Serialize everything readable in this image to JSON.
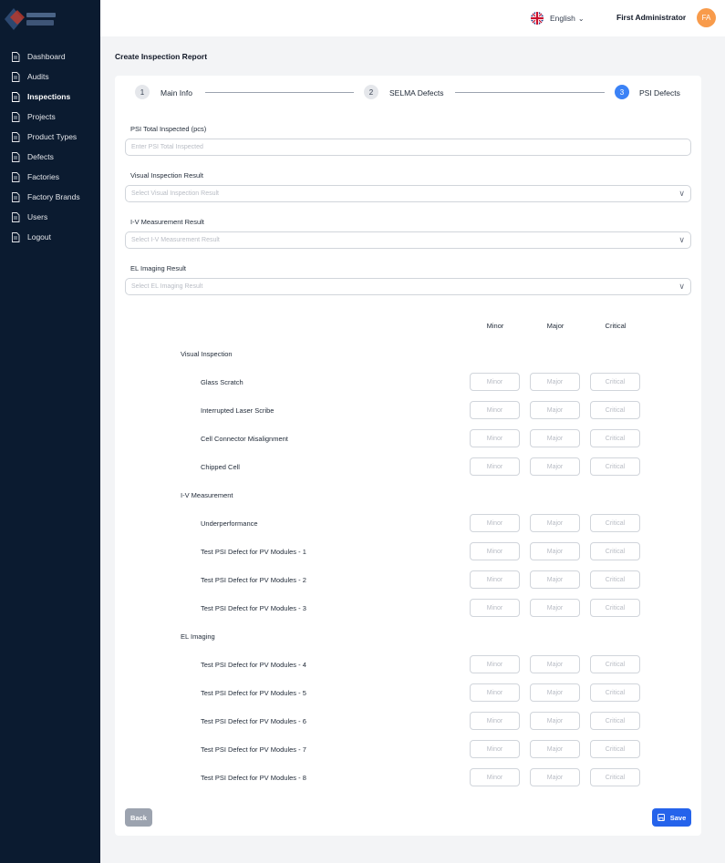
{
  "sidebar": {
    "items": [
      {
        "label": "Dashboard",
        "icon": "document-icon",
        "active": false
      },
      {
        "label": "Audits",
        "icon": "document-icon",
        "active": false
      },
      {
        "label": "Inspections",
        "icon": "document-icon",
        "active": true
      },
      {
        "label": "Projects",
        "icon": "document-icon",
        "active": false
      },
      {
        "label": "Product Types",
        "icon": "document-icon",
        "active": false
      },
      {
        "label": "Defects",
        "icon": "document-icon",
        "active": false
      },
      {
        "label": "Factories",
        "icon": "document-icon",
        "active": false
      },
      {
        "label": "Factory Brands",
        "icon": "document-icon",
        "active": false
      },
      {
        "label": "Users",
        "icon": "document-icon",
        "active": false
      },
      {
        "label": "Logout",
        "icon": "document-icon",
        "active": false
      }
    ]
  },
  "header": {
    "language": "English",
    "flag_icon": "uk-flag-icon",
    "user_name": "First Administrator",
    "avatar_initials": "FA",
    "avatar_color": "#f89b4b"
  },
  "page": {
    "title": "Create Inspection Report"
  },
  "stepper": {
    "steps": [
      {
        "number": "1",
        "label": "Main Info",
        "active": false
      },
      {
        "number": "2",
        "label": "SELMA Defects",
        "active": false
      },
      {
        "number": "3",
        "label": "PSI Defects",
        "active": true
      }
    ],
    "accent": "#3b82f6"
  },
  "form": {
    "total_inspected": {
      "label": "PSI Total Inspected (pcs)",
      "placeholder": "Enter PSI Total Inspected"
    },
    "visual_result": {
      "label": "Visual Inspection Result",
      "placeholder": "Select Visual Inspection Result"
    },
    "iv_result": {
      "label": "I-V Measurement Result",
      "placeholder": "Select I-V Measurement Result"
    },
    "el_result": {
      "label": "EL Imaging Result",
      "placeholder": "Select EL Imaging Result"
    }
  },
  "defects": {
    "columns": [
      "Minor",
      "Major",
      "Critical"
    ],
    "cell_placeholders": [
      "Minor",
      "Major",
      "Critical"
    ],
    "groups": [
      {
        "title": "Visual Inspection",
        "rows": [
          "Glass Scratch",
          "Interrupted Laser Scribe",
          "Cell Connector Misalignment",
          "Chipped Cell"
        ]
      },
      {
        "title": "I-V Measurement",
        "rows": [
          "Underperformance",
          "Test PSI Defect for PV Modules - 1",
          "Test PSI Defect for PV Modules - 2",
          "Test PSI Defect for PV Modules - 3"
        ]
      },
      {
        "title": "EL Imaging",
        "rows": [
          "Test PSI Defect for PV Modules - 4",
          "Test PSI Defect for PV Modules - 5",
          "Test PSI Defect for PV Modules - 6",
          "Test PSI Defect for PV Modules - 7",
          "Test PSI Defect for PV Modules - 8"
        ]
      }
    ]
  },
  "actions": {
    "back_label": "Back",
    "save_label": "Save",
    "save_icon": "save-icon",
    "save_color": "#2563eb"
  }
}
